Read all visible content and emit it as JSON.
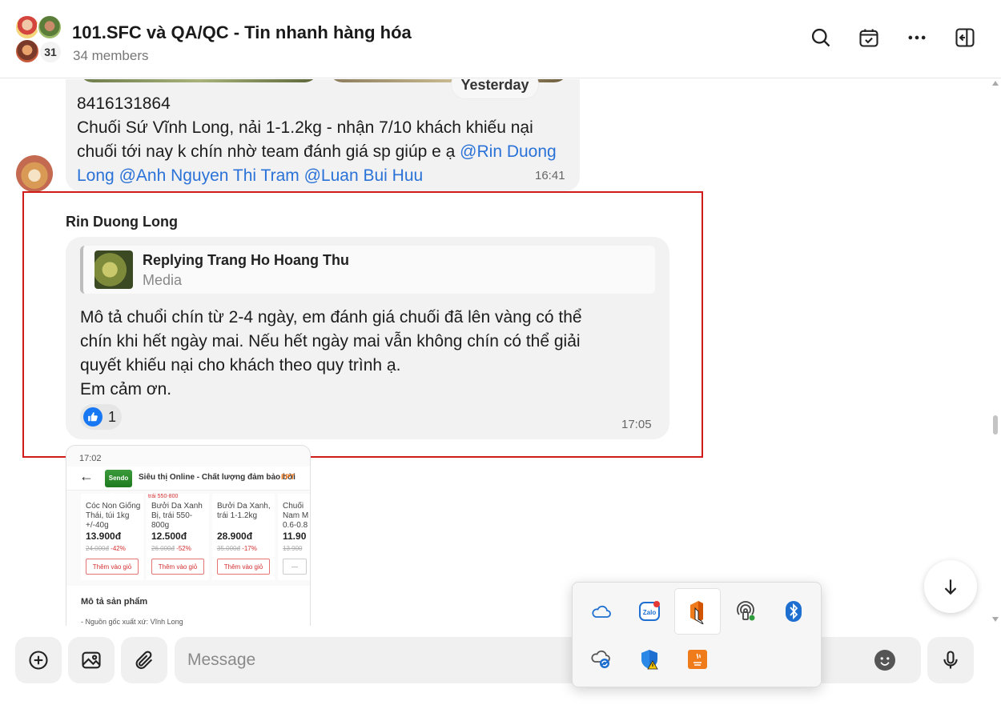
{
  "header": {
    "title": "101.SFC và QA/QC - Tin nhanh hàng hóa",
    "members": "34 members",
    "avatar_count": "31",
    "icons": [
      "search-icon",
      "calendar-check-icon",
      "more-icon",
      "sidebar-toggle-icon"
    ]
  },
  "messages": {
    "previous": {
      "date_divider": "Yesterday",
      "phone": "8416131864",
      "text": "Chuối Sứ Vĩnh Long, nải 1-1.2kg - nhận 7/10 khách khiếu nại chuối tới nay k chín nhờ team đánh giá sp giúp e ạ ",
      "mentions": [
        "@Rin Duong Long",
        "@Anh Nguyen Thi Tram",
        "@Luan Bui Huu"
      ],
      "time": "16:41"
    },
    "highlighted": {
      "sender": "Rin Duong Long",
      "reply_title": "Replying Trang Ho Hoang Thu",
      "reply_subtitle": "Media",
      "lines": [
        "Mô tả chuổi chín từ 2-4 ngày, em đánh giá chuối đã lên vàng có thể",
        "chín khi hết ngày mai. Nếu hết ngày mai vẫn không chín có thể giải",
        "quyết khiếu nại cho khách theo quy trình ạ.",
        "Em cảm ơn."
      ],
      "reaction_count": "1",
      "time": "17:05"
    },
    "screenshot": {
      "status_time": "17:02",
      "logo": "Sendo Farm",
      "title": "Siêu thị Online - Chất lượng đảm bảo bởi",
      "brand": "FPT",
      "products": [
        {
          "tag": "",
          "name": "Cóc Non Giống Thái, túi 1kg +/-40g",
          "price": "13.900đ",
          "old": "24.000đ",
          "discount": "-42%",
          "button": "Thêm vào giỏ"
        },
        {
          "tag": "trái 550-800",
          "name": "Bưởi Da Xanh Bị, trái 550-800g",
          "price": "12.500đ",
          "old": "26.000đ",
          "discount": "-52%",
          "button": "Thêm vào giỏ"
        },
        {
          "tag": "",
          "name": "Bưởi Da Xanh, trái 1-1.2kg",
          "price": "28.900đ",
          "old": "35.000đ",
          "discount": "-17%",
          "button": "Thêm vào giỏ"
        },
        {
          "tag": "",
          "name": "Chuối Nam M 0.6-0.8",
          "price": "11.90",
          "old": "13.900",
          "discount": "",
          "button": "—"
        }
      ],
      "section_title": "Mô tả sản phẩm",
      "section_line": "- Nguồn gốc xuất xứ: Vĩnh Long"
    }
  },
  "composer": {
    "placeholder": "Message"
  },
  "tray": {
    "items": [
      "onedrive-icon",
      "zalo-icon",
      "office-icon",
      "wireless-display-icon",
      "bluetooth-icon",
      "sync-cloud-icon",
      "windows-security-icon",
      "java-icon"
    ]
  },
  "colors": {
    "mention": "#2a72d8",
    "highlight_border": "#d11a1a",
    "like": "#1877f2"
  }
}
